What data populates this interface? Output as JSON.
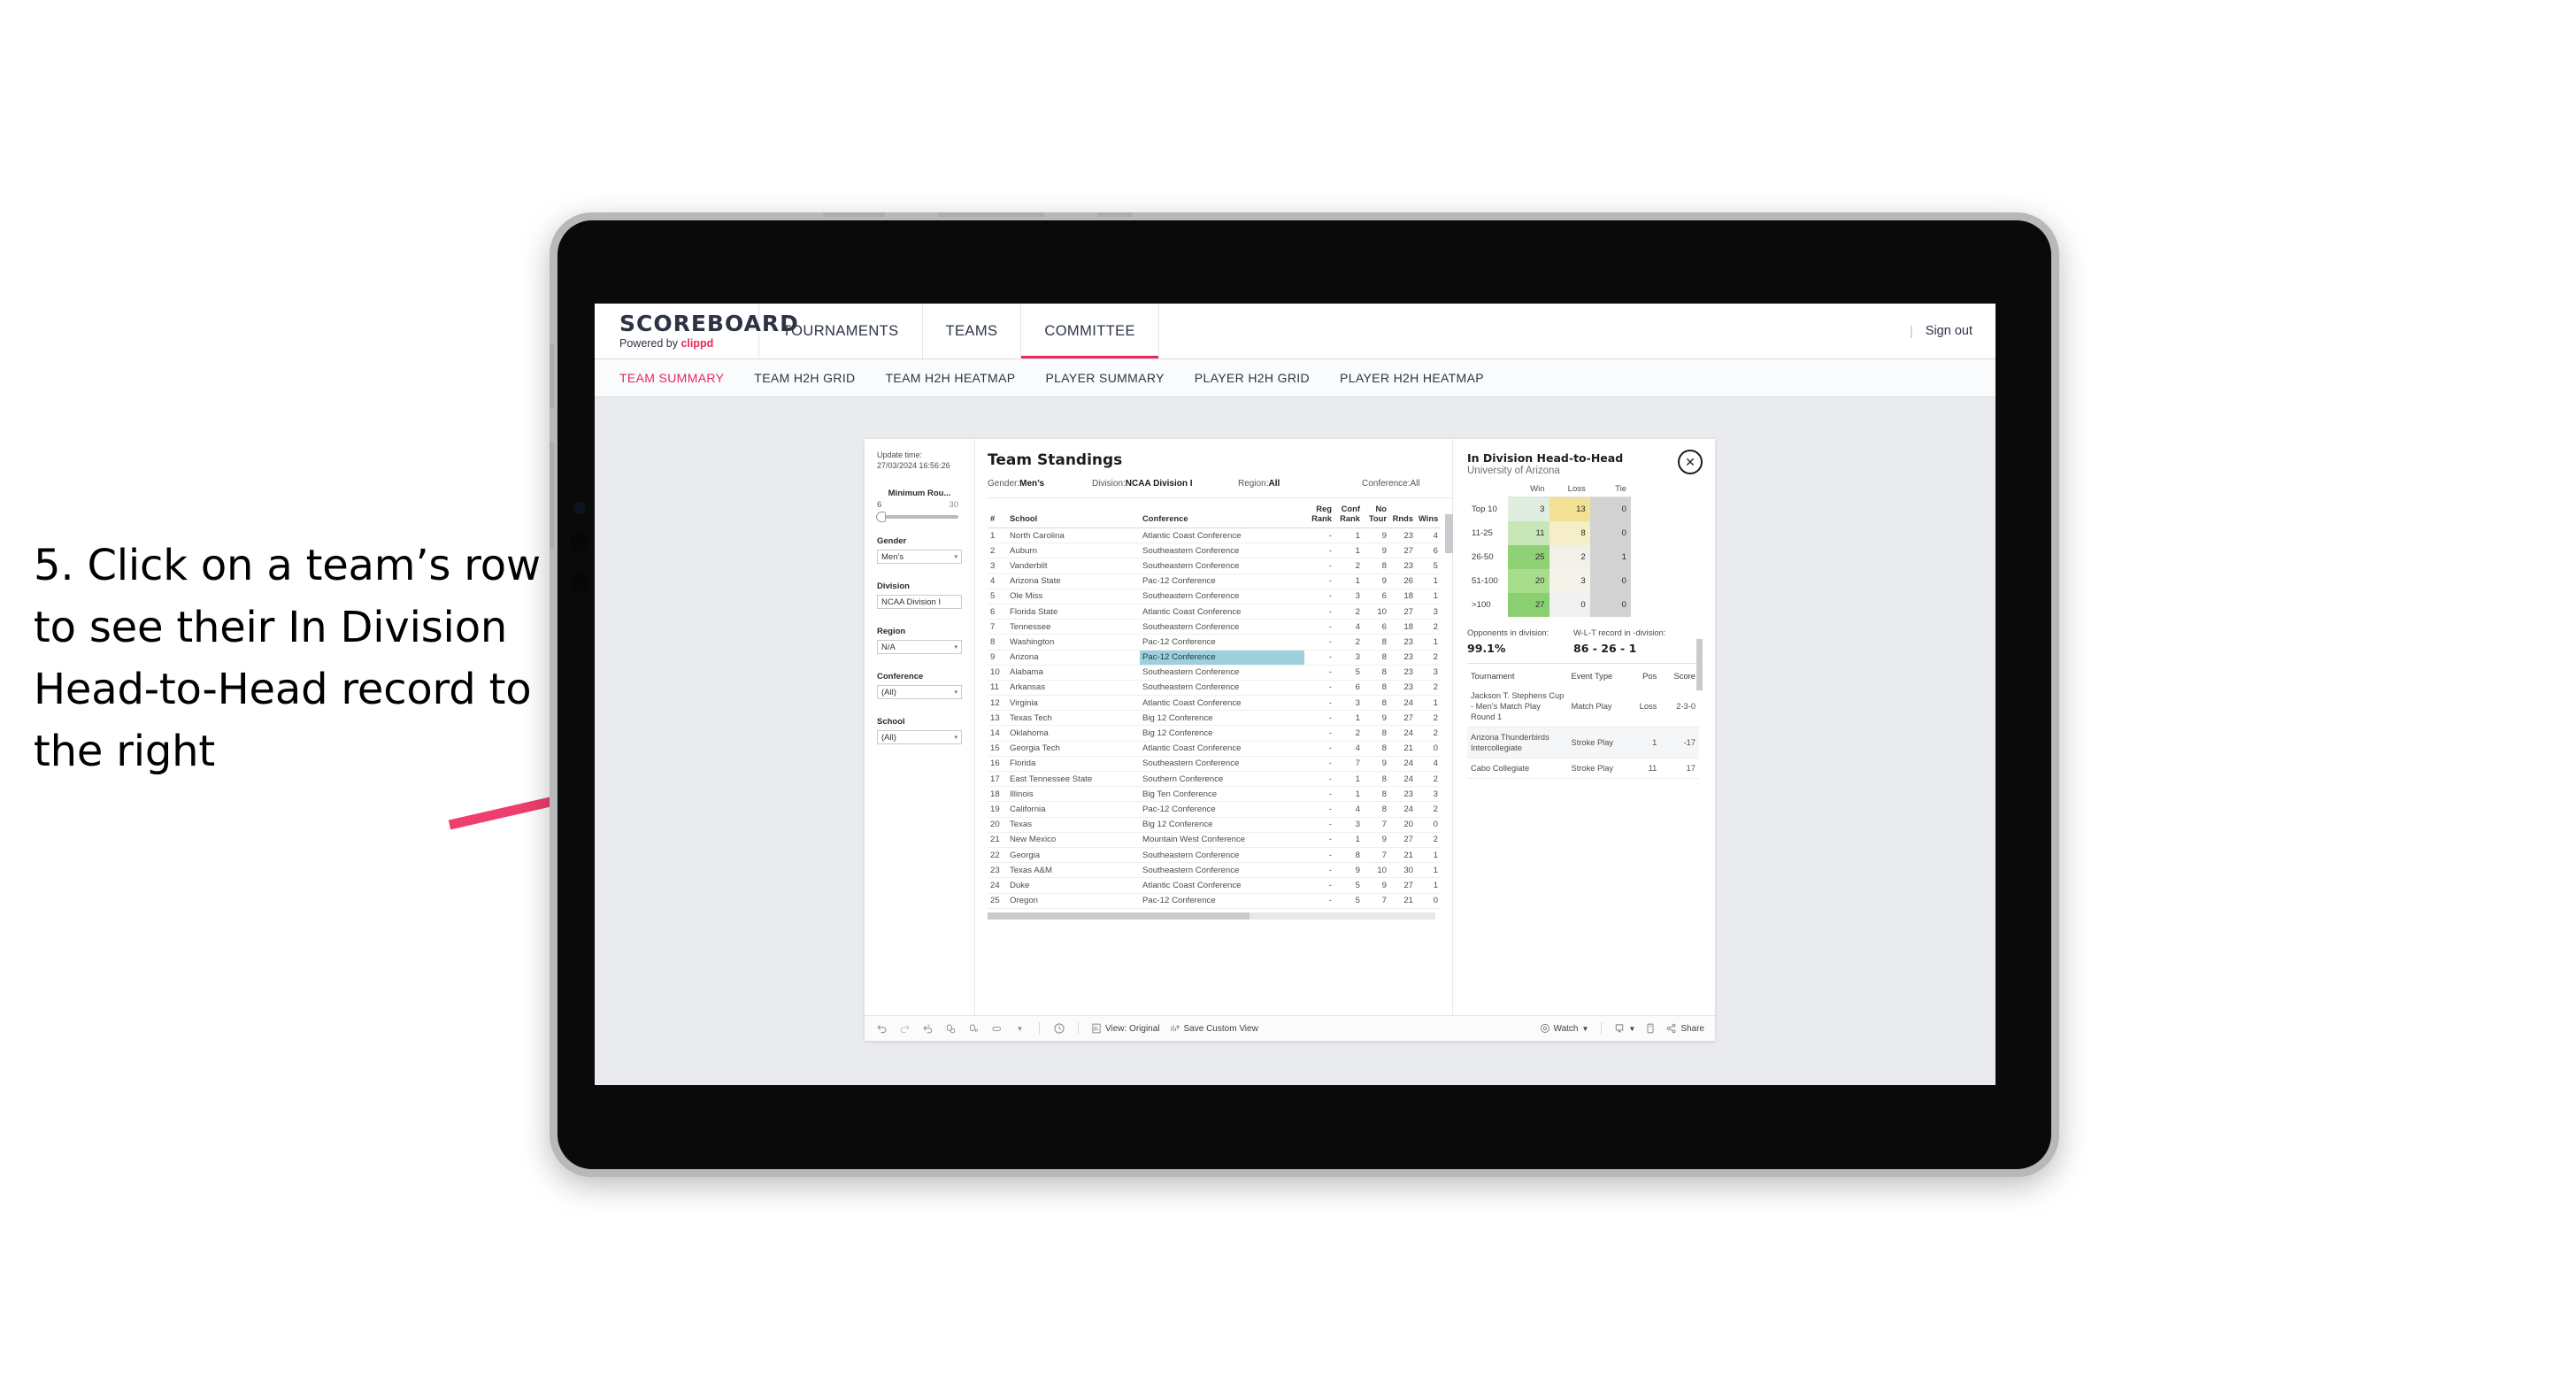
{
  "annotation": {
    "text": "5. Click on a team’s row to see their In Division Head-to-Head record to the right",
    "arrow_color": "#ef3e6d"
  },
  "app_header": {
    "brand_title": "SCOREBOARD",
    "brand_powered_prefix": "Powered by ",
    "brand_powered_name": "clippd",
    "nav": [
      {
        "label": "TOURNAMENTS",
        "active": false
      },
      {
        "label": "TEAMS",
        "active": false
      },
      {
        "label": "COMMITTEE",
        "active": true
      }
    ],
    "separator": "|",
    "sign_out": "Sign out",
    "accent_color": "#e8275a"
  },
  "subtabs": [
    {
      "label": "TEAM SUMMARY",
      "active": true
    },
    {
      "label": "TEAM H2H GRID",
      "active": false
    },
    {
      "label": "TEAM H2H HEATMAP",
      "active": false
    },
    {
      "label": "PLAYER SUMMARY",
      "active": false
    },
    {
      "label": "PLAYER H2H GRID",
      "active": false
    },
    {
      "label": "PLAYER H2H HEATMAP",
      "active": false
    }
  ],
  "filters": {
    "update_time_label": "Update time:",
    "update_time_value": "27/03/2024 16:56:26",
    "min_rounds_label": "Minimum Rou...",
    "min_rounds_low": "6",
    "min_rounds_high": "30",
    "groups": [
      {
        "label": "Gender",
        "value": "Men’s"
      },
      {
        "label": "Division",
        "value": "NCAA Division I"
      },
      {
        "label": "Region",
        "value": "N/A"
      },
      {
        "label": "Conference",
        "value": "(All)"
      },
      {
        "label": "School",
        "value": "(All)"
      }
    ]
  },
  "standings": {
    "title": "Team Standings",
    "summary": [
      {
        "label": "Gender: ",
        "value": "Men’s"
      },
      {
        "label": "Division: ",
        "value": "NCAA Division I"
      },
      {
        "label": "Region: ",
        "value": "All"
      },
      {
        "label": "Conference: ",
        "value": "All"
      }
    ],
    "columns": [
      "#",
      "School",
      "Conference",
      "Reg Rank",
      "Conf Rank",
      "No Tour",
      "Rnds",
      "Wins"
    ],
    "rows": [
      {
        "rank": "1",
        "school": "North Carolina",
        "conference": "Atlantic Coast Conference",
        "reg_rank": "-",
        "conf_rank": "1",
        "no_tour": "9",
        "rnds": "23",
        "wins": "4",
        "selected": false
      },
      {
        "rank": "2",
        "school": "Auburn",
        "conference": "Southeastern Conference",
        "reg_rank": "-",
        "conf_rank": "1",
        "no_tour": "9",
        "rnds": "27",
        "wins": "6",
        "selected": false
      },
      {
        "rank": "3",
        "school": "Vanderbilt",
        "conference": "Southeastern Conference",
        "reg_rank": "-",
        "conf_rank": "2",
        "no_tour": "8",
        "rnds": "23",
        "wins": "5",
        "selected": false
      },
      {
        "rank": "4",
        "school": "Arizona State",
        "conference": "Pac-12 Conference",
        "reg_rank": "-",
        "conf_rank": "1",
        "no_tour": "9",
        "rnds": "26",
        "wins": "1",
        "selected": false
      },
      {
        "rank": "5",
        "school": "Ole Miss",
        "conference": "Southeastern Conference",
        "reg_rank": "-",
        "conf_rank": "3",
        "no_tour": "6",
        "rnds": "18",
        "wins": "1",
        "selected": false
      },
      {
        "rank": "6",
        "school": "Florida State",
        "conference": "Atlantic Coast Conference",
        "reg_rank": "-",
        "conf_rank": "2",
        "no_tour": "10",
        "rnds": "27",
        "wins": "3",
        "selected": false
      },
      {
        "rank": "7",
        "school": "Tennessee",
        "conference": "Southeastern Conference",
        "reg_rank": "-",
        "conf_rank": "4",
        "no_tour": "6",
        "rnds": "18",
        "wins": "2",
        "selected": false
      },
      {
        "rank": "8",
        "school": "Washington",
        "conference": "Pac-12 Conference",
        "reg_rank": "-",
        "conf_rank": "2",
        "no_tour": "8",
        "rnds": "23",
        "wins": "1",
        "selected": false
      },
      {
        "rank": "9",
        "school": "Arizona",
        "conference": "Pac-12 Conference",
        "reg_rank": "-",
        "conf_rank": "3",
        "no_tour": "8",
        "rnds": "23",
        "wins": "2",
        "selected": true
      },
      {
        "rank": "10",
        "school": "Alabama",
        "conference": "Southeastern Conference",
        "reg_rank": "-",
        "conf_rank": "5",
        "no_tour": "8",
        "rnds": "23",
        "wins": "3",
        "selected": false
      },
      {
        "rank": "11",
        "school": "Arkansas",
        "conference": "Southeastern Conference",
        "reg_rank": "-",
        "conf_rank": "6",
        "no_tour": "8",
        "rnds": "23",
        "wins": "2",
        "selected": false
      },
      {
        "rank": "12",
        "school": "Virginia",
        "conference": "Atlantic Coast Conference",
        "reg_rank": "-",
        "conf_rank": "3",
        "no_tour": "8",
        "rnds": "24",
        "wins": "1",
        "selected": false
      },
      {
        "rank": "13",
        "school": "Texas Tech",
        "conference": "Big 12 Conference",
        "reg_rank": "-",
        "conf_rank": "1",
        "no_tour": "9",
        "rnds": "27",
        "wins": "2",
        "selected": false
      },
      {
        "rank": "14",
        "school": "Oklahoma",
        "conference": "Big 12 Conference",
        "reg_rank": "-",
        "conf_rank": "2",
        "no_tour": "8",
        "rnds": "24",
        "wins": "2",
        "selected": false
      },
      {
        "rank": "15",
        "school": "Georgia Tech",
        "conference": "Atlantic Coast Conference",
        "reg_rank": "-",
        "conf_rank": "4",
        "no_tour": "8",
        "rnds": "21",
        "wins": "0",
        "selected": false
      },
      {
        "rank": "16",
        "school": "Florida",
        "conference": "Southeastern Conference",
        "reg_rank": "-",
        "conf_rank": "7",
        "no_tour": "9",
        "rnds": "24",
        "wins": "4",
        "selected": false
      },
      {
        "rank": "17",
        "school": "East Tennessee State",
        "conference": "Southern Conference",
        "reg_rank": "-",
        "conf_rank": "1",
        "no_tour": "8",
        "rnds": "24",
        "wins": "2",
        "selected": false
      },
      {
        "rank": "18",
        "school": "Illinois",
        "conference": "Big Ten Conference",
        "reg_rank": "-",
        "conf_rank": "1",
        "no_tour": "8",
        "rnds": "23",
        "wins": "3",
        "selected": false
      },
      {
        "rank": "19",
        "school": "California",
        "conference": "Pac-12 Conference",
        "reg_rank": "-",
        "conf_rank": "4",
        "no_tour": "8",
        "rnds": "24",
        "wins": "2",
        "selected": false
      },
      {
        "rank": "20",
        "school": "Texas",
        "conference": "Big 12 Conference",
        "reg_rank": "-",
        "conf_rank": "3",
        "no_tour": "7",
        "rnds": "20",
        "wins": "0",
        "selected": false
      },
      {
        "rank": "21",
        "school": "New Mexico",
        "conference": "Mountain West Conference",
        "reg_rank": "-",
        "conf_rank": "1",
        "no_tour": "9",
        "rnds": "27",
        "wins": "2",
        "selected": false
      },
      {
        "rank": "22",
        "school": "Georgia",
        "conference": "Southeastern Conference",
        "reg_rank": "-",
        "conf_rank": "8",
        "no_tour": "7",
        "rnds": "21",
        "wins": "1",
        "selected": false
      },
      {
        "rank": "23",
        "school": "Texas A&M",
        "conference": "Southeastern Conference",
        "reg_rank": "-",
        "conf_rank": "9",
        "no_tour": "10",
        "rnds": "30",
        "wins": "1",
        "selected": false
      },
      {
        "rank": "24",
        "school": "Duke",
        "conference": "Atlantic Coast Conference",
        "reg_rank": "-",
        "conf_rank": "5",
        "no_tour": "9",
        "rnds": "27",
        "wins": "1",
        "selected": false
      },
      {
        "rank": "25",
        "school": "Oregon",
        "conference": "Pac-12 Conference",
        "reg_rank": "-",
        "conf_rank": "5",
        "no_tour": "7",
        "rnds": "21",
        "wins": "0",
        "selected": false
      }
    ],
    "selected_highlight_color": "#9ecfdd"
  },
  "h2h": {
    "title": "In Division Head-to-Head",
    "subtitle": "University of Arizona",
    "close_icon": "✕",
    "columns": [
      "",
      "Win",
      "Loss",
      "Tie"
    ],
    "rows": [
      {
        "bucket": "Top 10",
        "win": "3",
        "loss": "13",
        "tie": "0",
        "win_color": "#dfeede",
        "loss_color": "#f2e094",
        "tie_color": "#d2d2d2"
      },
      {
        "bucket": "11-25",
        "win": "11",
        "loss": "8",
        "tie": "0",
        "win_color": "#c9e6b9",
        "loss_color": "#f6edc9",
        "tie_color": "#d2d2d2"
      },
      {
        "bucket": "26-50",
        "win": "25",
        "loss": "2",
        "tie": "1",
        "win_color": "#8fd174",
        "loss_color": "#f2f0e8",
        "tie_color": "#d2d2d2"
      },
      {
        "bucket": "51-100",
        "win": "20",
        "loss": "3",
        "tie": "0",
        "win_color": "#a8dc8d",
        "loss_color": "#f5f2e9",
        "tie_color": "#d2d2d2"
      },
      {
        "bucket": ">100",
        "win": "27",
        "loss": "0",
        "tie": "0",
        "win_color": "#8bd070",
        "loss_color": "#f1f1f1",
        "tie_color": "#d2d2d2"
      }
    ],
    "stats": [
      {
        "label": "Opponents in division:",
        "value": "99.1%"
      },
      {
        "label": "W-L-T record in -division:",
        "value": "86 - 26 - 1"
      }
    ],
    "tournaments_columns": [
      "Tournament",
      "Event Type",
      "Pos",
      "Score"
    ],
    "tournaments": [
      {
        "name": "Jackson T. Stephens Cup - Men’s Match Play Round 1",
        "event_type": "Match Play",
        "pos": "Loss",
        "score": "2-3-0"
      },
      {
        "name": "Arizona Thunderbirds Intercollegiate",
        "event_type": "Stroke Play",
        "pos": "1",
        "score": "-17"
      },
      {
        "name": "Cabo Collegiate",
        "event_type": "Stroke Play",
        "pos": "11",
        "score": "17"
      }
    ]
  },
  "toolbar": {
    "icons": [
      "undo-icon",
      "redo-icon",
      "revert-icon",
      "refresh-data-icon",
      "pause-updates-icon",
      "highlight-icon",
      "dropdown-caret-icon",
      "clock-icon"
    ],
    "view_original": "View: Original",
    "save_custom_view": "Save Custom View",
    "watch": "Watch",
    "share": "Share"
  }
}
